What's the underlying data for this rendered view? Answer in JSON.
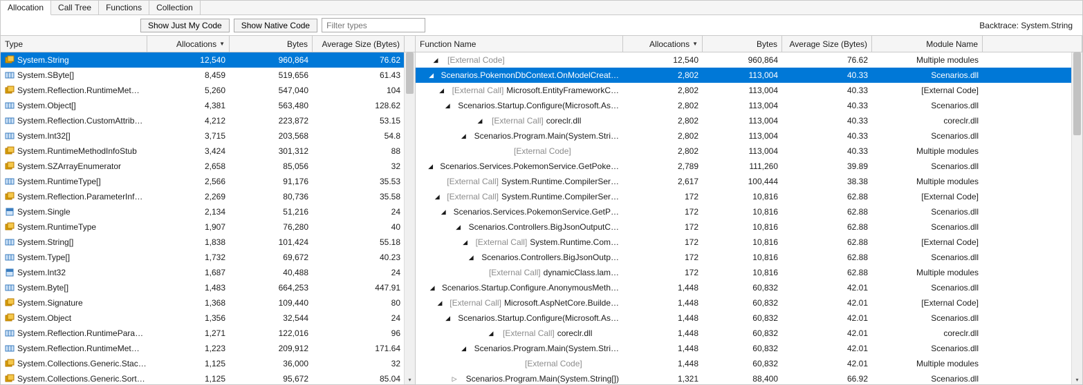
{
  "tabs": {
    "allocation": "Allocation",
    "call_tree": "Call Tree",
    "functions": "Functions",
    "collection": "Collection"
  },
  "toolbar": {
    "show_my_code": "Show Just My Code",
    "show_native": "Show Native Code",
    "filter_placeholder": "Filter types",
    "backtrace": "Backtrace: System.String"
  },
  "left": {
    "headers": {
      "type": "Type",
      "allocations": "Allocations",
      "bytes": "Bytes",
      "avg": "Average Size (Bytes)"
    },
    "rows": [
      {
        "icon": "class",
        "name": "System.String",
        "alloc": "12,540",
        "bytes": "960,864",
        "avg": "76.62",
        "sel": true
      },
      {
        "icon": "array",
        "name": "System.SByte[]",
        "alloc": "8,459",
        "bytes": "519,656",
        "avg": "61.43"
      },
      {
        "icon": "class",
        "name": "System.Reflection.RuntimeMet…",
        "alloc": "5,260",
        "bytes": "547,040",
        "avg": "104"
      },
      {
        "icon": "array",
        "name": "System.Object[]",
        "alloc": "4,381",
        "bytes": "563,480",
        "avg": "128.62"
      },
      {
        "icon": "array",
        "name": "System.Reflection.CustomAttrib…",
        "alloc": "4,212",
        "bytes": "223,872",
        "avg": "53.15"
      },
      {
        "icon": "array",
        "name": "System.Int32[]",
        "alloc": "3,715",
        "bytes": "203,568",
        "avg": "54.8"
      },
      {
        "icon": "class",
        "name": "System.RuntimeMethodInfoStub",
        "alloc": "3,424",
        "bytes": "301,312",
        "avg": "88"
      },
      {
        "icon": "class",
        "name": "System.SZArrayEnumerator",
        "alloc": "2,658",
        "bytes": "85,056",
        "avg": "32"
      },
      {
        "icon": "array",
        "name": "System.RuntimeType[]",
        "alloc": "2,566",
        "bytes": "91,176",
        "avg": "35.53"
      },
      {
        "icon": "class",
        "name": "System.Reflection.ParameterInf…",
        "alloc": "2,269",
        "bytes": "80,736",
        "avg": "35.58"
      },
      {
        "icon": "struct",
        "name": "System.Single",
        "alloc": "2,134",
        "bytes": "51,216",
        "avg": "24"
      },
      {
        "icon": "class",
        "name": "System.RuntimeType",
        "alloc": "1,907",
        "bytes": "76,280",
        "avg": "40"
      },
      {
        "icon": "array",
        "name": "System.String[]",
        "alloc": "1,838",
        "bytes": "101,424",
        "avg": "55.18"
      },
      {
        "icon": "array",
        "name": "System.Type[]",
        "alloc": "1,732",
        "bytes": "69,672",
        "avg": "40.23"
      },
      {
        "icon": "struct",
        "name": "System.Int32",
        "alloc": "1,687",
        "bytes": "40,488",
        "avg": "24"
      },
      {
        "icon": "array",
        "name": "System.Byte[]",
        "alloc": "1,483",
        "bytes": "664,253",
        "avg": "447.91"
      },
      {
        "icon": "class",
        "name": "System.Signature",
        "alloc": "1,368",
        "bytes": "109,440",
        "avg": "80"
      },
      {
        "icon": "class",
        "name": "System.Object",
        "alloc": "1,356",
        "bytes": "32,544",
        "avg": "24"
      },
      {
        "icon": "array",
        "name": "System.Reflection.RuntimePara…",
        "alloc": "1,271",
        "bytes": "122,016",
        "avg": "96"
      },
      {
        "icon": "array",
        "name": "System.Reflection.RuntimeMet…",
        "alloc": "1,223",
        "bytes": "209,912",
        "avg": "171.64"
      },
      {
        "icon": "class",
        "name": "System.Collections.Generic.Stac…",
        "alloc": "1,125",
        "bytes": "36,000",
        "avg": "32"
      },
      {
        "icon": "class",
        "name": "System.Collections.Generic.Sort…",
        "alloc": "1,125",
        "bytes": "95,672",
        "avg": "85.04"
      }
    ]
  },
  "right": {
    "headers": {
      "fn": "Function Name",
      "allocations": "Allocations",
      "bytes": "Bytes",
      "avg": "Average Size (Bytes)",
      "module": "Module Name"
    },
    "rows": [
      {
        "ind": 0,
        "exp": "open",
        "ext": "",
        "txt": "[External Code]",
        "extonly": true,
        "alloc": "12,540",
        "bytes": "960,864",
        "avg": "76.62",
        "mod": "Multiple modules"
      },
      {
        "ind": 1,
        "exp": "open",
        "txt": "Scenarios.PokemonDbContext.OnModelCreat…",
        "alloc": "2,802",
        "bytes": "113,004",
        "avg": "40.33",
        "mod": "Scenarios.dll",
        "sel": true
      },
      {
        "ind": 2,
        "exp": "open",
        "ext": "[External Call] ",
        "txt": "Microsoft.EntityFrameworkC…",
        "alloc": "2,802",
        "bytes": "113,004",
        "avg": "40.33",
        "mod": "[External Code]"
      },
      {
        "ind": 3,
        "exp": "open",
        "txt": "Scenarios.Startup.Configure(Microsoft.As…",
        "alloc": "2,802",
        "bytes": "113,004",
        "avg": "40.33",
        "mod": "Scenarios.dll"
      },
      {
        "ind": 4,
        "exp": "open",
        "ext": "[External Call] ",
        "txt": "coreclr.dll",
        "alloc": "2,802",
        "bytes": "113,004",
        "avg": "40.33",
        "mod": "coreclr.dll"
      },
      {
        "ind": 5,
        "exp": "open",
        "txt": "Scenarios.Program.Main(System.Stri…",
        "alloc": "2,802",
        "bytes": "113,004",
        "avg": "40.33",
        "mod": "Scenarios.dll"
      },
      {
        "ind": 6,
        "exp": "",
        "txt": "[External Code]",
        "extonly": true,
        "alloc": "2,802",
        "bytes": "113,004",
        "avg": "40.33",
        "mod": "Multiple modules"
      },
      {
        "ind": 2,
        "exp": "open",
        "txt": "Scenarios.Services.PokemonService.GetPoke…",
        "alloc": "2,789",
        "bytes": "111,260",
        "avg": "39.89",
        "mod": "Scenarios.dll"
      },
      {
        "ind": 3,
        "exp": "",
        "ext": "[External Call] ",
        "txt": "System.Runtime.CompilerSer…",
        "alloc": "2,617",
        "bytes": "100,444",
        "avg": "38.38",
        "mod": "Multiple modules"
      },
      {
        "ind": 3,
        "exp": "open",
        "ext": "[External Call] ",
        "txt": "System.Runtime.CompilerSer…",
        "alloc": "172",
        "bytes": "10,816",
        "avg": "62.88",
        "mod": "[External Code]"
      },
      {
        "ind": 4,
        "exp": "open",
        "txt": "Scenarios.Services.PokemonService.GetP…",
        "alloc": "172",
        "bytes": "10,816",
        "avg": "62.88",
        "mod": "Scenarios.dll"
      },
      {
        "ind": 5,
        "exp": "open",
        "txt": "Scenarios.Controllers.BigJsonOutputC…",
        "alloc": "172",
        "bytes": "10,816",
        "avg": "62.88",
        "mod": "Scenarios.dll"
      },
      {
        "ind": 6,
        "exp": "open",
        "ext": "[External Call] ",
        "txt": "System.Runtime.Com…",
        "alloc": "172",
        "bytes": "10,816",
        "avg": "62.88",
        "mod": "[External Code]"
      },
      {
        "ind": 7,
        "exp": "open",
        "txt": "Scenarios.Controllers.BigJsonOutp…",
        "alloc": "172",
        "bytes": "10,816",
        "avg": "62.88",
        "mod": "Scenarios.dll"
      },
      {
        "ind": 8,
        "exp": "",
        "ext": "[External Call] ",
        "txt": "dynamicClass.lam…",
        "alloc": "172",
        "bytes": "10,816",
        "avg": "62.88",
        "mod": "Multiple modules"
      },
      {
        "ind": 2,
        "exp": "open",
        "txt": "Scenarios.Startup.Configure.AnonymousMeth…",
        "alloc": "1,448",
        "bytes": "60,832",
        "avg": "42.01",
        "mod": "Scenarios.dll"
      },
      {
        "ind": 3,
        "exp": "open",
        "ext": "[External Call] ",
        "txt": "Microsoft.AspNetCore.Builde…",
        "alloc": "1,448",
        "bytes": "60,832",
        "avg": "42.01",
        "mod": "[External Code]"
      },
      {
        "ind": 4,
        "exp": "open",
        "txt": "Scenarios.Startup.Configure(Microsoft.As…",
        "alloc": "1,448",
        "bytes": "60,832",
        "avg": "42.01",
        "mod": "Scenarios.dll"
      },
      {
        "ind": 5,
        "exp": "open",
        "ext": "[External Call] ",
        "txt": "coreclr.dll",
        "alloc": "1,448",
        "bytes": "60,832",
        "avg": "42.01",
        "mod": "coreclr.dll"
      },
      {
        "ind": 6,
        "exp": "open",
        "txt": "Scenarios.Program.Main(System.Stri…",
        "alloc": "1,448",
        "bytes": "60,832",
        "avg": "42.01",
        "mod": "Scenarios.dll"
      },
      {
        "ind": 7,
        "exp": "",
        "txt": "[External Code]",
        "extonly": true,
        "alloc": "1,448",
        "bytes": "60,832",
        "avg": "42.01",
        "mod": "Multiple modules"
      },
      {
        "ind": 2,
        "exp": "closed",
        "txt": "Scenarios.Program.Main(System.String[])",
        "alloc": "1,321",
        "bytes": "88,400",
        "avg": "66.92",
        "mod": "Scenarios.dll"
      }
    ]
  }
}
